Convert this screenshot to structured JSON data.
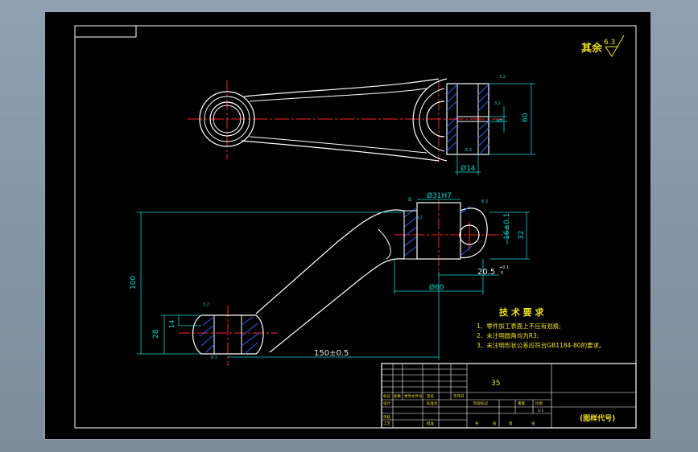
{
  "sheet": {
    "background": "#000000",
    "frame_color": "#ffffff",
    "dim_color": "#00d8d8",
    "center_color": "#ff2020",
    "hatch_color": "#2060ff",
    "text_yellow": "#f0e020"
  },
  "roughness": {
    "prefix": "其余",
    "value": "6.3"
  },
  "top_view": {
    "dims": {
      "height": "60",
      "slot": "5",
      "bore": "Ø14",
      "rough1": "3.2",
      "rough2": "3.2",
      "rough3": "6.3"
    }
  },
  "front_view": {
    "dims": {
      "bore": "Ø31H7",
      "hole_pos": "16±0.1",
      "height32": "32",
      "offset": "20.5",
      "offset_tol_upper": "+0.1",
      "offset_tol_lower": "0",
      "dia60": "Ø60",
      "overall_height": "100",
      "boss28": "28",
      "boss14": "14",
      "center_dist": "150±0.5",
      "rough1": "3.2",
      "rough2": "6.3",
      "rough3": "3.2",
      "rough4": "6.3",
      "datum": "B"
    }
  },
  "notes": {
    "title": "技 术 要 求",
    "items": [
      "1、零件加工表面上不应有划痕;",
      "2、未注明圆角均为R3;",
      "3、未注明形状公差应符合GB1184-80的要求。"
    ]
  },
  "title_block": {
    "material": "35",
    "drawing_code": "(图样代号)",
    "labels": [
      "标记",
      "处数",
      "更改文件号",
      "签名",
      "年月日",
      "设计",
      "标准化",
      "阶段标记",
      "重量",
      "比例",
      "审核",
      "工艺",
      "批准",
      "共",
      "张",
      "第",
      "张"
    ],
    "scale": "1:1"
  }
}
